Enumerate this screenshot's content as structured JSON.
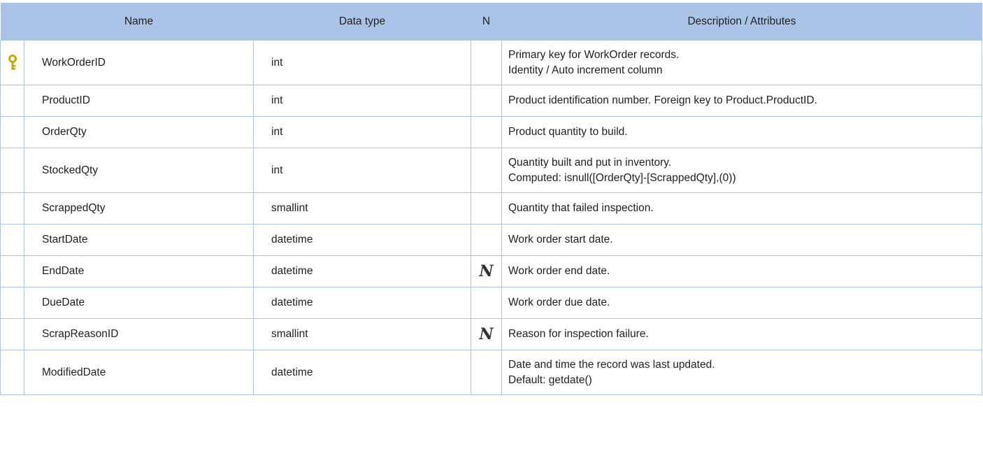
{
  "header": {
    "name": "Name",
    "data_type": "Data type",
    "nullable": "N",
    "description": "Description / Attributes"
  },
  "key_icon_color": "#c9a800",
  "header_color": "#a9c4e6",
  "rows": [
    {
      "primary_key": true,
      "name": "WorkOrderID",
      "type": "int",
      "nullable": "",
      "desc1": "Primary key for WorkOrder records.",
      "desc2": "Identity / Auto increment column"
    },
    {
      "primary_key": false,
      "name": "ProductID",
      "type": "int",
      "nullable": "",
      "desc1": "Product identification number. Foreign key to Product.ProductID.",
      "desc2": ""
    },
    {
      "primary_key": false,
      "name": "OrderQty",
      "type": "int",
      "nullable": "",
      "desc1": "Product quantity to build.",
      "desc2": ""
    },
    {
      "primary_key": false,
      "name": "StockedQty",
      "type": "int",
      "nullable": "",
      "desc1": "Quantity built and put in inventory.",
      "desc2": "Computed: isnull([OrderQty]-[ScrappedQty],(0))"
    },
    {
      "primary_key": false,
      "name": "ScrappedQty",
      "type": "smallint",
      "nullable": "",
      "desc1": "Quantity that failed inspection.",
      "desc2": ""
    },
    {
      "primary_key": false,
      "name": "StartDate",
      "type": "datetime",
      "nullable": "",
      "desc1": "Work order start date.",
      "desc2": ""
    },
    {
      "primary_key": false,
      "name": "EndDate",
      "type": "datetime",
      "nullable": "N",
      "desc1": "Work order end date.",
      "desc2": ""
    },
    {
      "primary_key": false,
      "name": "DueDate",
      "type": "datetime",
      "nullable": "",
      "desc1": "Work order due date.",
      "desc2": ""
    },
    {
      "primary_key": false,
      "name": "ScrapReasonID",
      "type": "smallint",
      "nullable": "N",
      "desc1": "Reason for inspection failure.",
      "desc2": ""
    },
    {
      "primary_key": false,
      "name": "ModifiedDate",
      "type": "datetime",
      "nullable": "",
      "desc1": "Date and time the record was last updated.",
      "desc2": "Default: getdate()"
    }
  ]
}
